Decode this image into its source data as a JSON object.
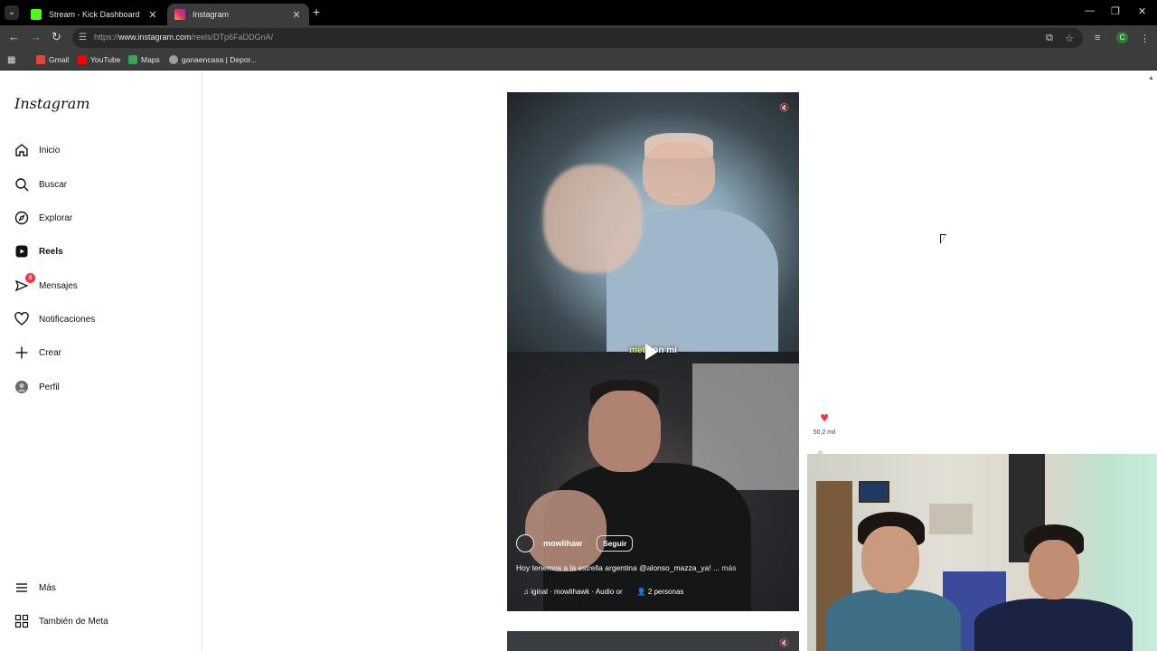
{
  "browser": {
    "tabs": [
      {
        "title": "Stream - Kick Dashboard",
        "active": false,
        "favicon_color": "#53fc18"
      },
      {
        "title": "Instagram",
        "active": true,
        "favicon_color": "#e1306c"
      }
    ],
    "url_prefix": "https://",
    "url_domain": "www.instagram.com",
    "url_path": "/reels/DTp6FaDDGnA/",
    "profile_initial": "C",
    "bookmarks": [
      {
        "label": "Gmail",
        "icon": "gmail-icon",
        "color": "#ea4335"
      },
      {
        "label": "YouTube",
        "icon": "youtube-icon",
        "color": "#ff0000"
      },
      {
        "label": "Maps",
        "icon": "maps-icon",
        "color": "#34a853"
      },
      {
        "label": "ganaencasa | Depor...",
        "icon": "globe-icon",
        "color": "#9e9e9e"
      }
    ]
  },
  "sidebar": {
    "logo": "Instagram",
    "items": [
      {
        "label": "Inicio",
        "icon": "home-icon"
      },
      {
        "label": "Buscar",
        "icon": "search-icon"
      },
      {
        "label": "Explorar",
        "icon": "compass-icon"
      },
      {
        "label": "Reels",
        "icon": "reels-icon",
        "active": true
      },
      {
        "label": "Mensajes",
        "icon": "messenger-icon",
        "badge": "8"
      },
      {
        "label": "Notificaciones",
        "icon": "heart-icon"
      },
      {
        "label": "Crear",
        "icon": "plus-icon"
      },
      {
        "label": "Perfil",
        "icon": "avatar-icon"
      }
    ],
    "more_label": "Más",
    "meta_label": "También de Meta"
  },
  "reel": {
    "caption_overlay_highlight": "metic",
    "caption_overlay_rest": "on mi",
    "username": "mowlihaw",
    "follow_label": "Seguir",
    "description": "Hoy tenemos a la estrella argentina @alonso_mazza_ya! ...",
    "more_label": "más",
    "audio_label": "iginal · mowlihawk · Audio or",
    "people_label": "2 personas",
    "likes": "50,2 mil"
  }
}
